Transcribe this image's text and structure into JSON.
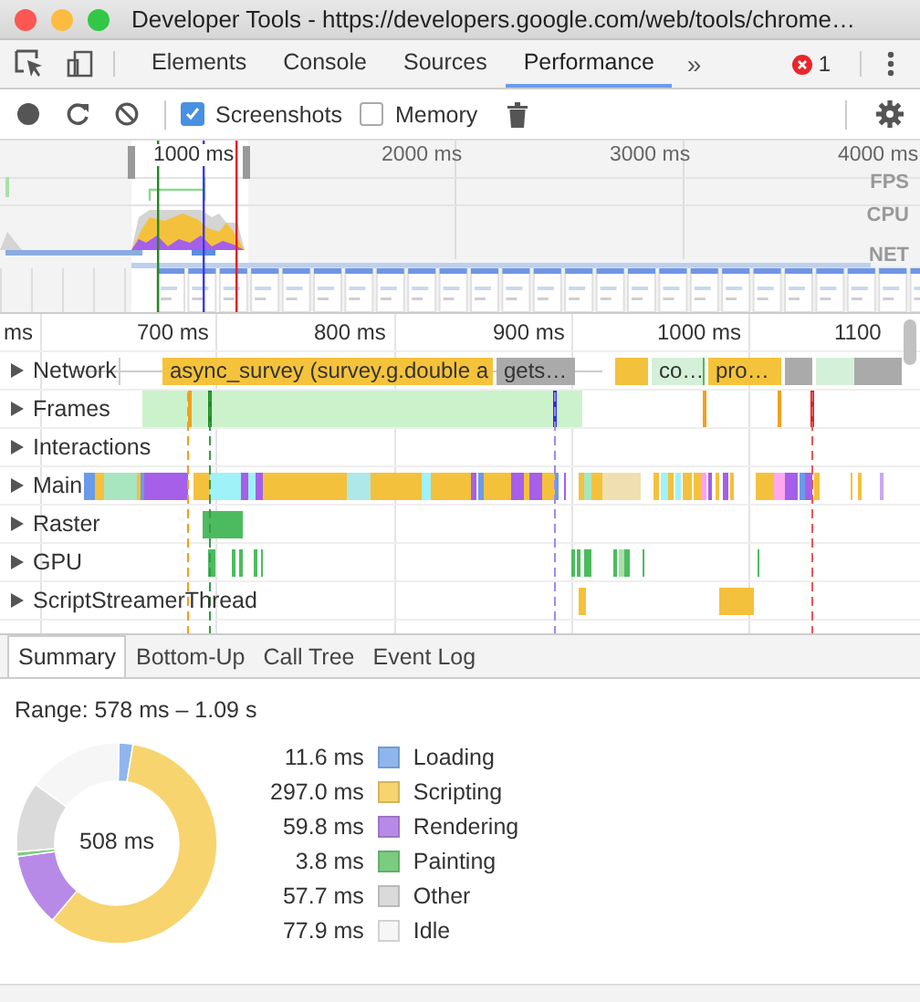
{
  "window": {
    "title": "Developer Tools - https://developers.google.com/web/tools/chrome…"
  },
  "panel_tabs": [
    {
      "label": "Elements",
      "selected": false
    },
    {
      "label": "Console",
      "selected": false
    },
    {
      "label": "Sources",
      "selected": false
    },
    {
      "label": "Performance",
      "selected": true
    }
  ],
  "more_tabs": "»",
  "error_count": "1",
  "toolbar": {
    "checkboxes": [
      {
        "label": "Screenshots",
        "checked": true
      },
      {
        "label": "Memory",
        "checked": false
      }
    ]
  },
  "overview": {
    "ticks": [
      "1000 ms",
      "2000 ms",
      "3000 ms",
      "4000 ms"
    ],
    "lanes": [
      "FPS",
      "CPU",
      "NET"
    ]
  },
  "timeline": {
    "ruler": [
      "ms",
      "700 ms",
      "800 ms",
      "900 ms",
      "1000 ms",
      "1100"
    ],
    "network_requests": [
      {
        "label": "async_survey (survey.g.double a",
        "color": "#f5c33b"
      },
      {
        "label": "gets…",
        "color": "#aaaaaa"
      },
      {
        "label": "co…",
        "color": "#d5f0d8"
      },
      {
        "label": "pro…",
        "color": "#f5c33b"
      }
    ],
    "tracks": [
      {
        "name": "Network",
        "kind": "network",
        "expanded": false
      },
      {
        "name": "Frames",
        "kind": "frames",
        "expanded": false
      },
      {
        "name": "Interactions",
        "kind": "empty",
        "expanded": false
      },
      {
        "name": "Main",
        "kind": "main",
        "expanded": false
      },
      {
        "name": "Raster",
        "kind": "raster",
        "expanded": false
      },
      {
        "name": "GPU",
        "kind": "gpu",
        "expanded": false
      },
      {
        "name": "ScriptStreamerThread",
        "kind": "streamer",
        "expanded": false
      }
    ]
  },
  "details_tabs": [
    {
      "label": "Summary",
      "selected": true
    },
    {
      "label": "Bottom-Up",
      "selected": false
    },
    {
      "label": "Call Tree",
      "selected": false
    },
    {
      "label": "Event Log",
      "selected": false
    }
  ],
  "summary": {
    "range": "Range: 578 ms – 1.09 s",
    "total": "508 ms",
    "legend": [
      {
        "value": "11.6 ms",
        "color": "#8fb5ef"
      },
      {
        "value": "297.0 ms",
        "color": "#f7d46e"
      },
      {
        "value": "59.8 ms",
        "color": "#b88ae8"
      },
      {
        "value": "3.8 ms",
        "color": "#7acc7f"
      },
      {
        "value": "57.7 ms",
        "color": "#dadada"
      },
      {
        "value": "77.9 ms",
        "color": "#f6f6f6"
      }
    ],
    "chart_data": {
      "type": "donut",
      "categories": [
        "Loading",
        "Scripting",
        "Rendering",
        "Painting",
        "Other",
        "Idle"
      ],
      "values": [
        2.28,
        58.49,
        11.78,
        0.75,
        11.36,
        15.34
      ]
    }
  }
}
